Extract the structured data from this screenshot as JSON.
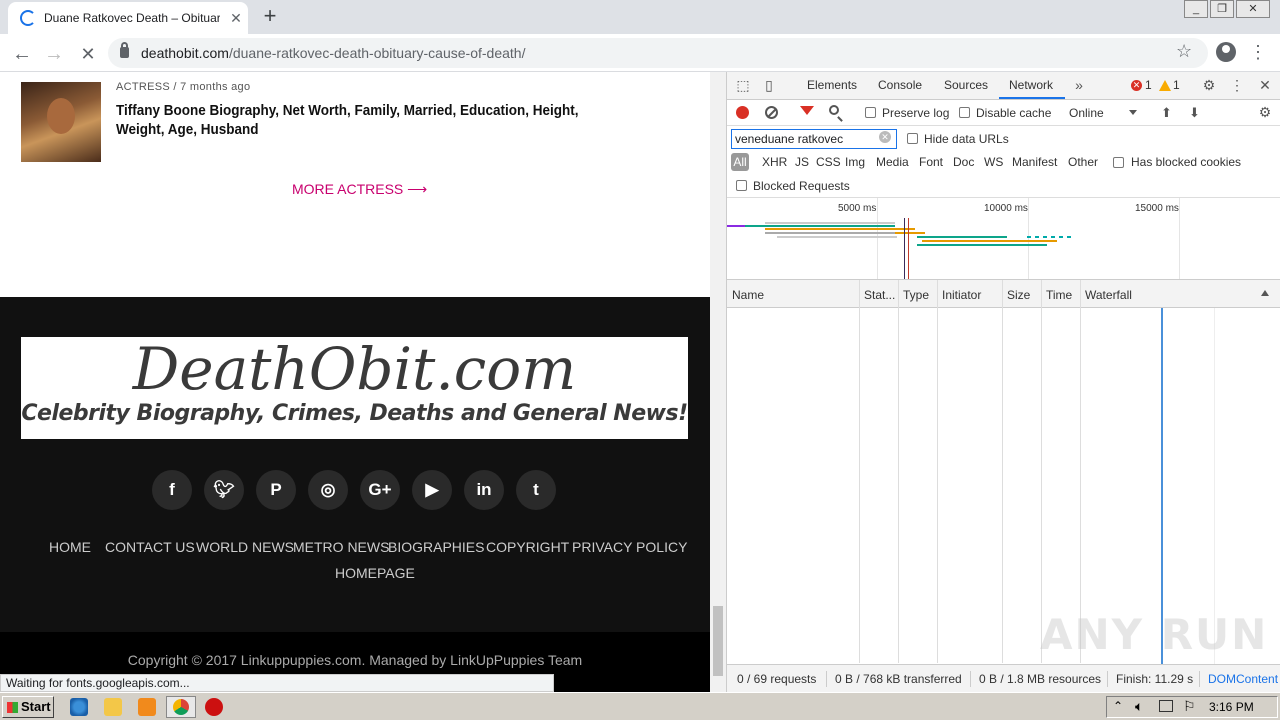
{
  "browser": {
    "tab_title": "Duane Ratkovec Death – Obituary, C",
    "url_domain": "deathobit.com",
    "url_path": "/duane-ratkovec-death-obituary-cause-of-death/",
    "status_text": "Waiting for fonts.googleapis.com..."
  },
  "page": {
    "article_category": "ACTRESS",
    "article_sep": "/",
    "article_time": "7 months ago",
    "article_title": "Tiffany Boone Biography, Net Worth, Family, Married, Education, Height, Weight, Age, Husband",
    "more_link": "MORE ACTRESS",
    "logo_main": "DeathObit.com",
    "logo_sub": "Celebrity Biography, Crimes, Deaths and General News!",
    "social": [
      "f",
      "t",
      "p",
      "ig",
      "G+",
      "yt",
      "in",
      "t"
    ],
    "footer_nav": [
      "HOME",
      "CONTACT US",
      "WORLD NEWS",
      "METRO NEWS",
      "BIOGRAPHIES",
      "COPYRIGHT",
      "PRIVACY POLICY",
      "HOMEPAGE"
    ],
    "copyright": "Copyright © 2017 Linkuppuppies.com. Managed by LinkUpPuppies Team"
  },
  "devtools": {
    "tabs": [
      "Elements",
      "Console",
      "Sources",
      "Network"
    ],
    "active_tab": "Network",
    "errors": "1",
    "warnings": "1",
    "preserve_log": "Preserve log",
    "disable_cache": "Disable cache",
    "throttle": "Online",
    "filter_value": "veneduane ratkovec",
    "hide_data_urls": "Hide data URLs",
    "types": [
      "All",
      "XHR",
      "JS",
      "CSS",
      "Img",
      "Media",
      "Font",
      "Doc",
      "WS",
      "Manifest",
      "Other"
    ],
    "has_blocked_cookies": "Has blocked cookies",
    "blocked_requests": "Blocked Requests",
    "overview_ticks": [
      "5000 ms",
      "10000 ms",
      "15000 ms"
    ],
    "columns": [
      "Name",
      "Stat...",
      "Type",
      "Initiator",
      "Size",
      "Time",
      "Waterfall"
    ],
    "status": {
      "requests": "0 / 69 requests",
      "transferred": "0 B / 768 kB transferred",
      "resources": "0 B / 1.8 MB resources",
      "finish": "Finish: 11.29 s",
      "dom": "DOMContent"
    }
  },
  "taskbar": {
    "start": "Start",
    "clock": "3:16 PM"
  },
  "watermark": "ANY RUN"
}
